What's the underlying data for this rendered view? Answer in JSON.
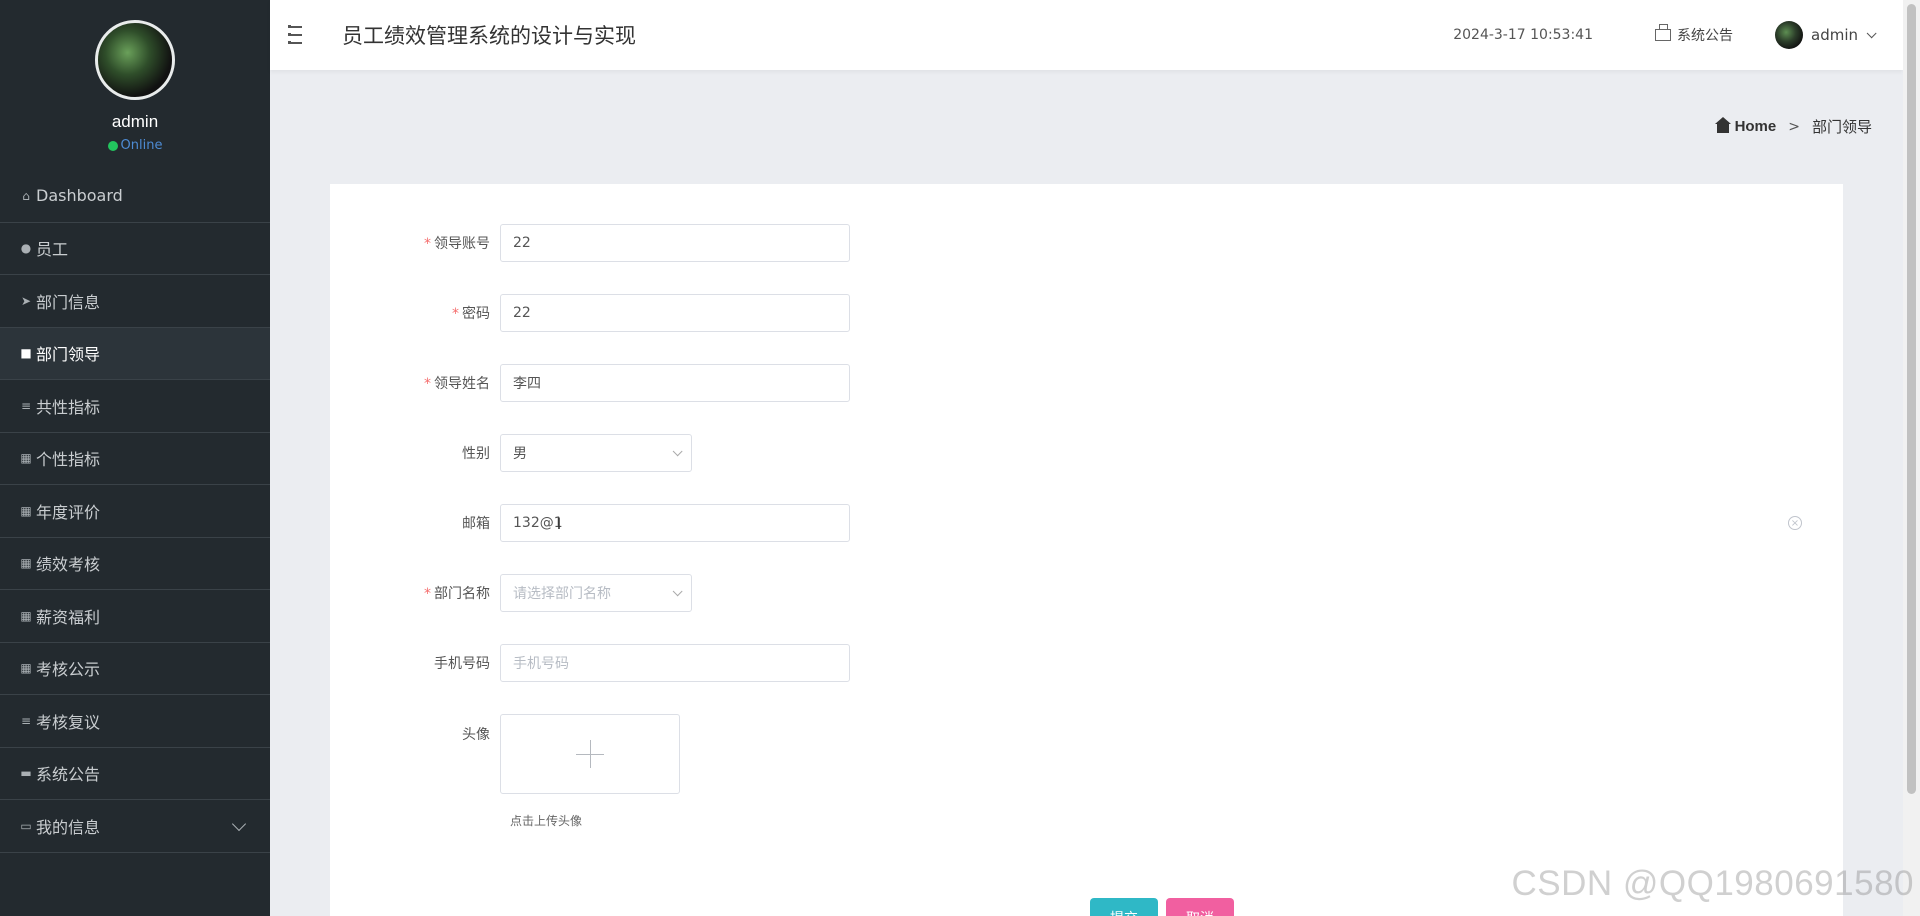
{
  "sidebar": {
    "user": {
      "name": "admin",
      "status": "Online"
    },
    "items": [
      {
        "label": "Dashboard",
        "icon": "house-icon",
        "glyph": "⌂"
      },
      {
        "label": "员工",
        "icon": "map-pin-icon",
        "glyph": "●"
      },
      {
        "label": "部门信息",
        "icon": "paper-plane-icon",
        "glyph": "➤"
      },
      {
        "label": "部门领导",
        "icon": "id-card-icon",
        "glyph": "■"
      },
      {
        "label": "共性指标",
        "icon": "list-icon",
        "glyph": "≡"
      },
      {
        "label": "个性指标",
        "icon": "grid-icon",
        "glyph": "▦"
      },
      {
        "label": "年度评价",
        "icon": "grid-icon",
        "glyph": "▦"
      },
      {
        "label": "绩效考核",
        "icon": "grid-icon",
        "glyph": "▦"
      },
      {
        "label": "薪资福利",
        "icon": "grid-icon",
        "glyph": "▦"
      },
      {
        "label": "考核公示",
        "icon": "grid-icon",
        "glyph": "▦"
      },
      {
        "label": "考核复议",
        "icon": "list-icon",
        "glyph": "≡"
      },
      {
        "label": "系统公告",
        "icon": "ticket-icon",
        "glyph": "▬"
      },
      {
        "label": "我的信息",
        "icon": "window-icon",
        "glyph": "▭"
      }
    ]
  },
  "header": {
    "title": "员工绩效管理系统的设计与实现",
    "datetime": "2024-3-17 10:53:41",
    "notice_label": "系统公告",
    "username": "admin"
  },
  "breadcrumb": {
    "home": "Home",
    "separator": ">",
    "current": "部门领导"
  },
  "form": {
    "account": {
      "label": "领导账号",
      "value": "22"
    },
    "password": {
      "label": "密码",
      "value": "22"
    },
    "name": {
      "label": "领导姓名",
      "value": "李四"
    },
    "gender": {
      "label": "性别",
      "value": "男"
    },
    "email": {
      "label": "邮箱",
      "value": "132@1"
    },
    "department": {
      "label": "部门名称",
      "placeholder": "请选择部门名称"
    },
    "phone": {
      "label": "手机号码",
      "placeholder": "手机号码"
    },
    "avatar": {
      "label": "头像",
      "tip": "点击上传头像"
    },
    "submit_label": "提交",
    "cancel_label": "取消",
    "required_mark": "*"
  },
  "watermark": "CSDN @QQ1980691580",
  "colors": {
    "sidebar_bg": "#232a2f",
    "submit": "#2fb8c6",
    "cancel": "#f15fa0",
    "required": "#f56c6c",
    "online": "#22c55e"
  }
}
